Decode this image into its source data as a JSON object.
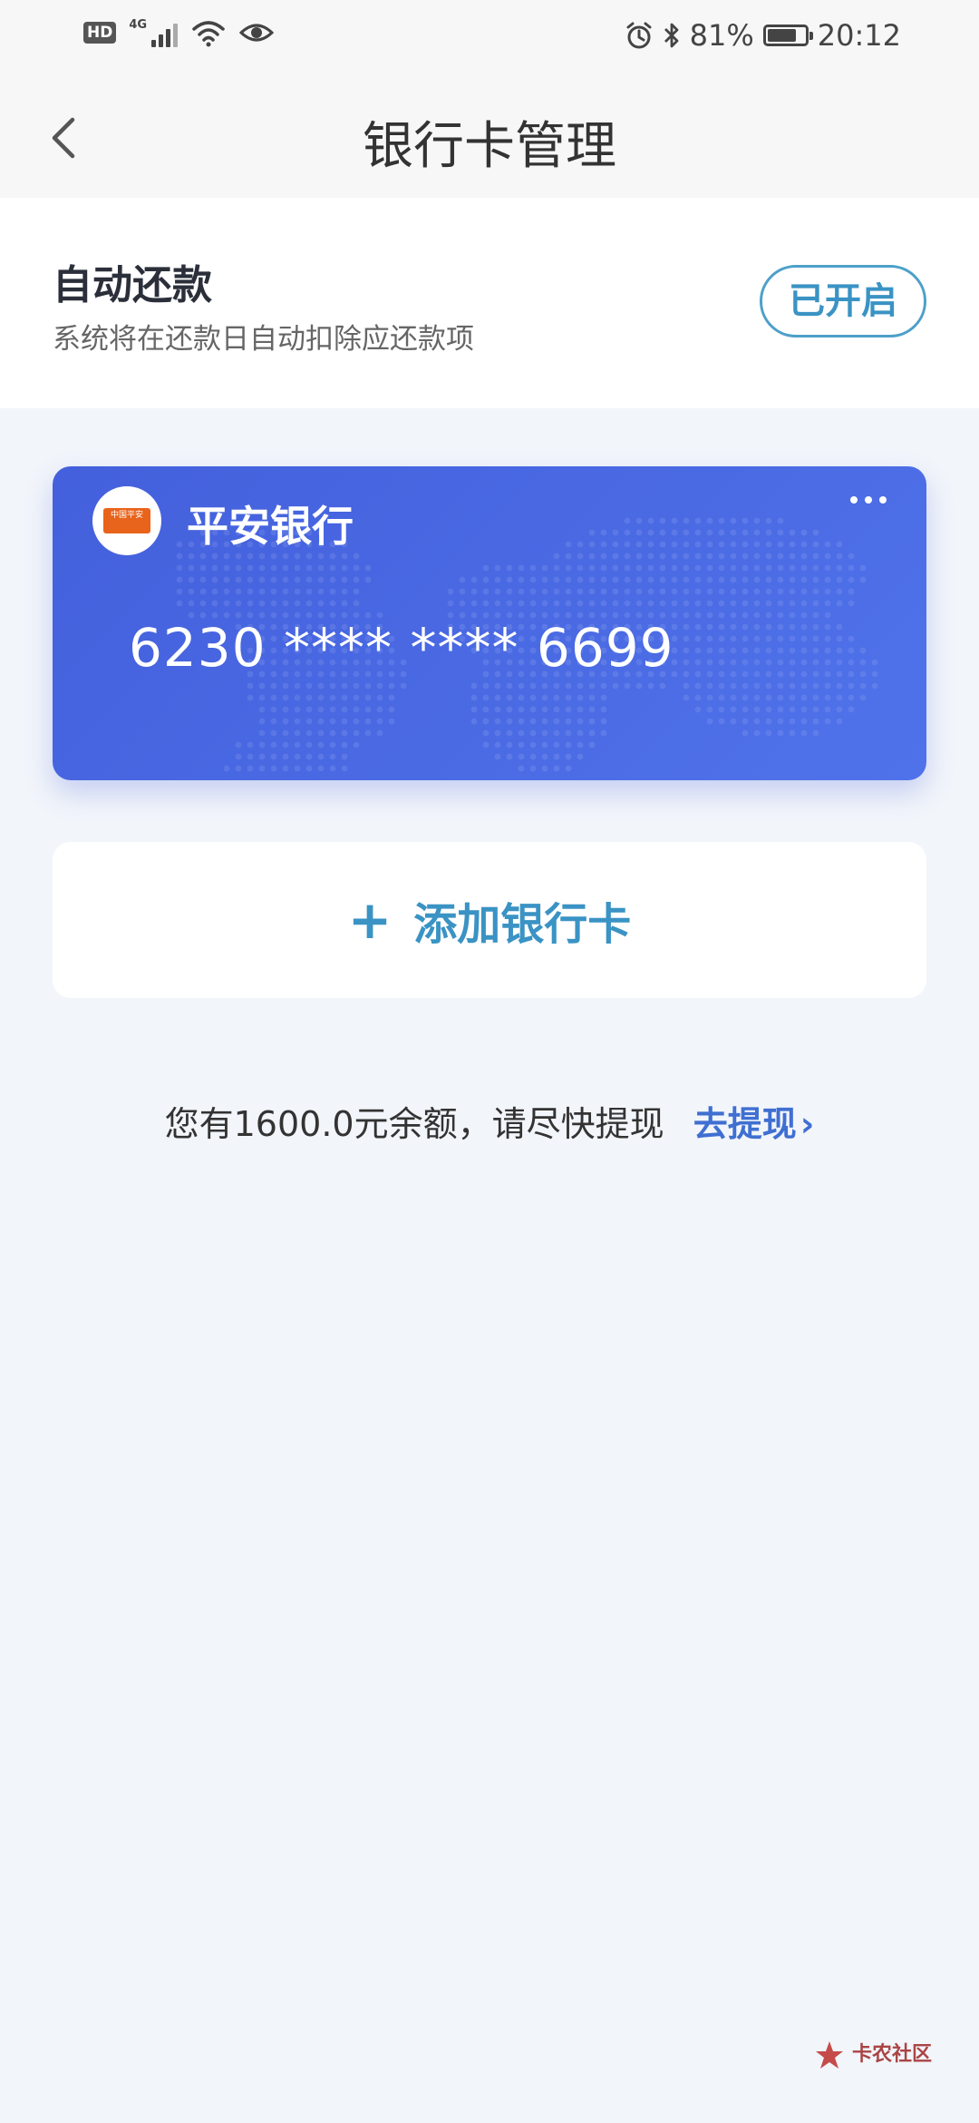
{
  "status_bar": {
    "hd": "HD",
    "network": "4G",
    "battery": "81%",
    "battery_level": 0.81,
    "time": "20:12"
  },
  "header": {
    "title": "银行卡管理"
  },
  "autopay": {
    "title": "自动还款",
    "description": "系统将在还款日自动扣除应还款项",
    "button_label": "已开启"
  },
  "card": {
    "bank_name": "平安银行",
    "logo_text": "中国平安",
    "card_number": "6230 **** **** 6699",
    "gradient_start": "#4460dc",
    "gradient_end": "#4f72ea"
  },
  "add_card": {
    "plus": "+",
    "label": "添加银行卡"
  },
  "balance": {
    "text": "您有1600.0元余额，请尽快提现",
    "withdraw_label": "去提现",
    "withdraw_chevron": "›"
  },
  "watermark": {
    "title": "卡农社区"
  },
  "colors": {
    "accent_teal": "#3a93c4",
    "link_blue": "#3f6fd1",
    "background": "#f2f5fa"
  }
}
